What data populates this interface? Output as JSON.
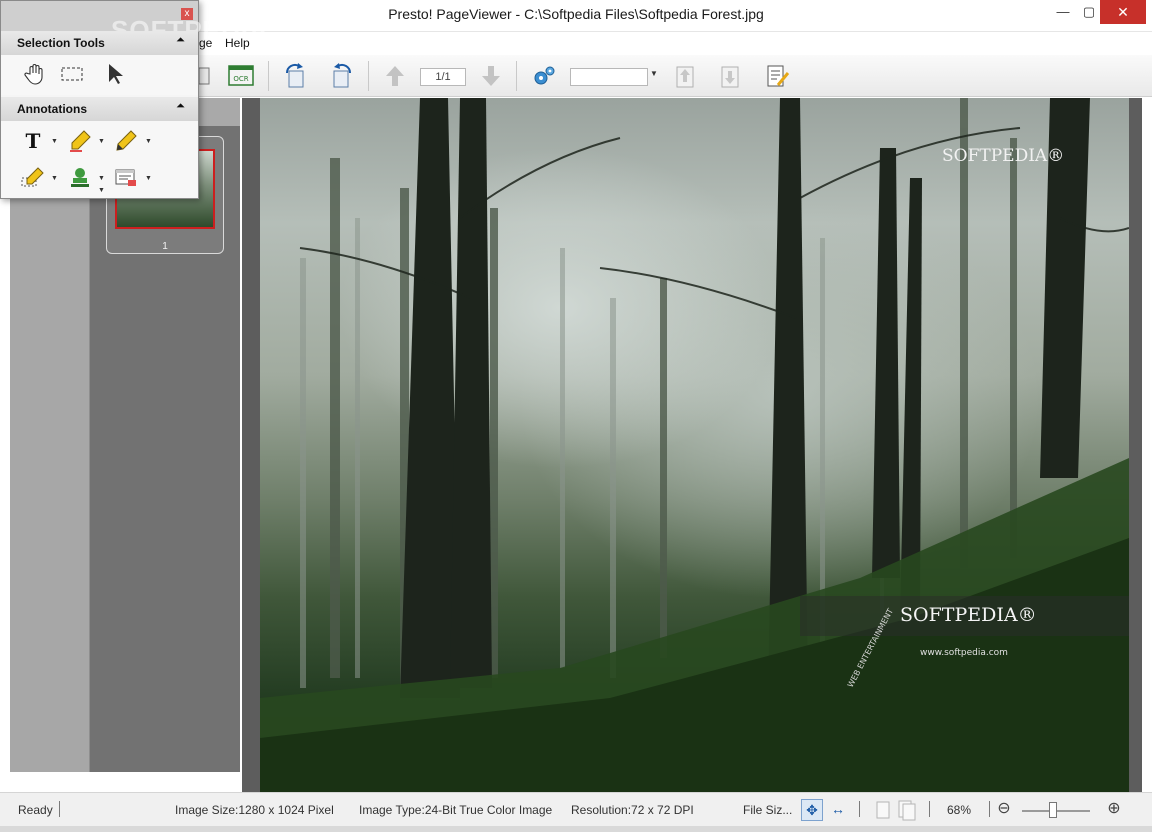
{
  "window": {
    "title": "Presto! PageViewer - C:\\Softpedia Files\\Softpedia Forest.jpg",
    "minimize": "—",
    "maximize": "▢",
    "close": "✕"
  },
  "menu": {
    "items": [
      {
        "label": "ge"
      },
      {
        "label": "Help"
      }
    ]
  },
  "toolbar": {
    "page_indicator": "1/1",
    "zoom_value": "",
    "icons": [
      "ocr-icon",
      "rotate-left-icon",
      "rotate-right-icon",
      "page-up-icon",
      "page-down-icon",
      "settings-gear-icon",
      "insert-page-icon",
      "extract-page-icon",
      "edit-properties-icon"
    ]
  },
  "thumbnail": {
    "page_number": "1"
  },
  "palette": {
    "close": "x",
    "selection_tools": {
      "title": "Selection Tools",
      "collapse": "⏶",
      "tools": [
        "hand-tool-icon",
        "rectangle-select-icon",
        "pointer-icon"
      ]
    },
    "annotations": {
      "title": "Annotations",
      "collapse": "⏶",
      "tools": [
        "text-annotation-icon",
        "highlighter-icon",
        "pencil-icon",
        "marker-icon",
        "stamp-icon",
        "note-icon"
      ]
    }
  },
  "image": {
    "watermark_top": "SOFTPEDIA®",
    "watermark_bottom": "SOFTPEDIA®",
    "url": "www.softpedia.com",
    "curved_text": "WEB ENTERTAINMENT"
  },
  "overlay_watermark": "SOFTPEDIA",
  "status": {
    "ready": "Ready",
    "image_size": "Image Size:1280 x 1024 Pixel",
    "image_type": "Image Type:24-Bit True Color Image",
    "resolution": "Resolution:72 x 72 DPI",
    "file_size": "File Siz...",
    "zoom_percent": "68%",
    "zoom_out": "⊖",
    "zoom_in": "⊕",
    "zoom_level_fraction": 0.45
  },
  "colors": {
    "accent_blue": "#1b5aa6",
    "close_red": "#c7302a",
    "thumb_border": "#cc1f1f"
  }
}
